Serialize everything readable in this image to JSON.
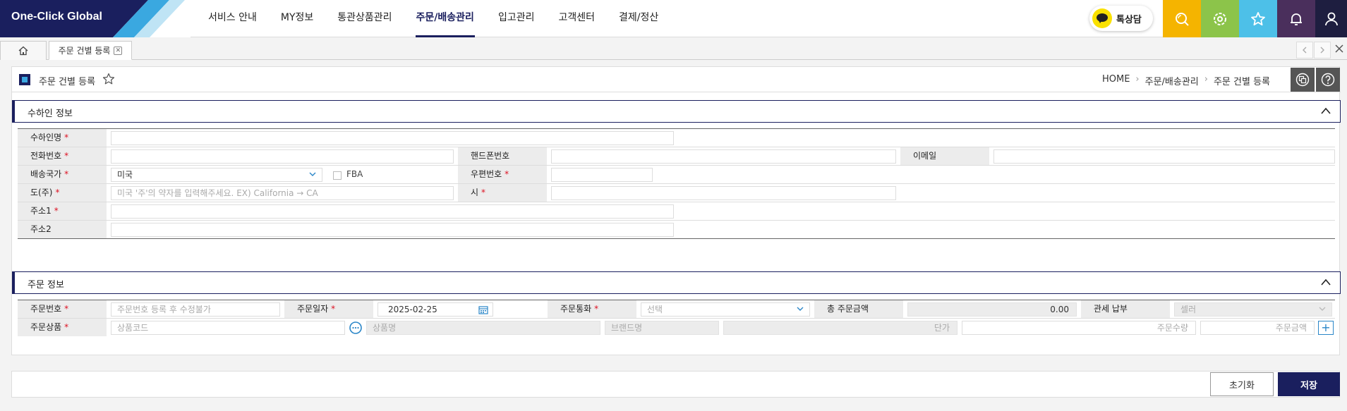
{
  "app": {
    "logo_text": "One-Click Global"
  },
  "nav": {
    "items": [
      "서비스 안내",
      "MY정보",
      "통관상품관리",
      "주문/배송관리",
      "입고관리",
      "고객센터",
      "결제/정산"
    ],
    "active_index": 3
  },
  "quick": {
    "kakao_label": "톡상담",
    "colors": {
      "search": "#f5b400",
      "settings": "#8cc44a",
      "favorite": "#4dc0e8",
      "alarm": "#4a2f5c",
      "user": "#1e1e40"
    }
  },
  "tabs": {
    "page_tab_label": "주문 건별 등록",
    "close_glyph": "✕"
  },
  "header": {
    "title": "주문 건별 등록",
    "breadcrumb": [
      "HOME",
      "주문/배송관리",
      "주문 건별 등록"
    ],
    "sep": "›"
  },
  "receiver": {
    "section_title": "수하인 정보",
    "labels": {
      "name": "수하인명",
      "phone": "전화번호",
      "mobile": "핸드폰번호",
      "email": "이메일",
      "country": "배송국가",
      "postal": "우편번호",
      "state": "도(주)",
      "city": "시",
      "addr1": "주소1",
      "addr2": "주소2"
    },
    "country_value": "미국",
    "fba_label": "FBA",
    "state_placeholder": "미국 '주'의 약자를 입력해주세요. EX) California → CA"
  },
  "order": {
    "section_title": "주문 정보",
    "labels": {
      "order_no": "주문번호",
      "order_date": "주문일자",
      "currency": "주문통화",
      "total": "총 주문금액",
      "duty": "관세 납부",
      "product": "주문상품"
    },
    "order_no_placeholder": "주문번호 등록 후 수정불가",
    "order_date_value": "2025-02-25",
    "currency_placeholder": "선택",
    "total_value": "0.00",
    "duty_value": "셀러",
    "product_code_placeholder": "상품코드",
    "product_name_placeholder": "상품명",
    "brand_placeholder": "브랜드명",
    "unit_price_placeholder": "단가",
    "qty_placeholder": "주문수량",
    "amount_placeholder": "주문금액",
    "plus_glyph": "+"
  },
  "required_mark": "*",
  "actions": {
    "reset": "초기화",
    "save": "저장"
  },
  "colors": {
    "brand": "#1a1f5e",
    "accent": "#3aa8e0",
    "required": "#dd1122"
  }
}
